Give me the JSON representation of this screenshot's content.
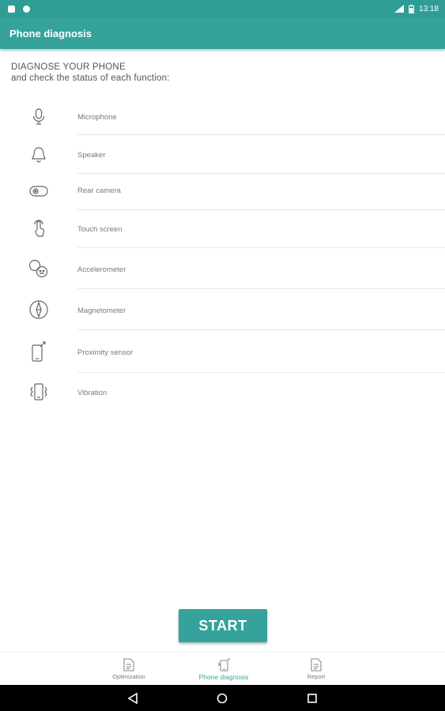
{
  "status_bar": {
    "time": "13:18"
  },
  "app_bar": {
    "title": "Phone diagnosis"
  },
  "intro": {
    "heading": "DIAGNOSE YOUR PHONE",
    "subheading": "and check the status of each function:"
  },
  "functions": [
    {
      "label": "Microphone",
      "icon": "microphone-icon"
    },
    {
      "label": "Speaker",
      "icon": "speaker-icon"
    },
    {
      "label": "Rear camera",
      "icon": "rear-camera-icon"
    },
    {
      "label": "Touch screen",
      "icon": "touch-screen-icon"
    },
    {
      "label": "Accelerometer",
      "icon": "accelerometer-icon"
    },
    {
      "label": "Magnetometer",
      "icon": "magnetometer-icon"
    },
    {
      "label": "Proximity sensor",
      "icon": "proximity-sensor-icon"
    },
    {
      "label": "Vibration",
      "icon": "vibration-icon"
    }
  ],
  "start_button": {
    "label": "START"
  },
  "bottom_nav": {
    "items": [
      {
        "label": "Optimization",
        "active": false
      },
      {
        "label": "Phone diagnosis",
        "active": true
      },
      {
        "label": "Report",
        "active": false
      }
    ]
  },
  "colors": {
    "accent": "#35a39c",
    "status_bar": "#2f9c96"
  }
}
